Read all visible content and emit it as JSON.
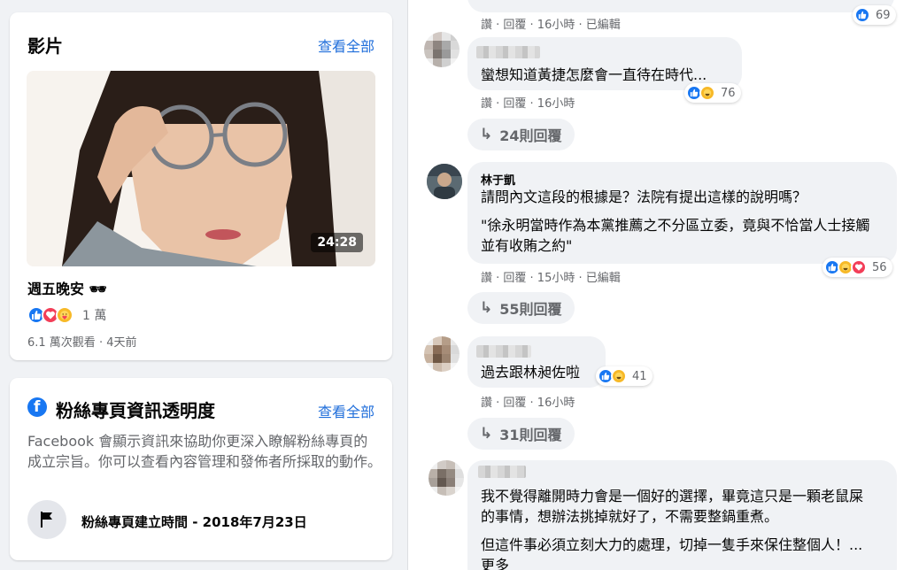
{
  "video_section": {
    "title": "影片",
    "see_all": "查看全部",
    "duration": "24:28",
    "video_title": "週五晚安 🕶",
    "reaction_count": "1 萬",
    "meta": "6.1 萬次觀看 · 4天前"
  },
  "transparency": {
    "title": "粉絲專頁資訊透明度",
    "see_all": "查看全部",
    "logo": "f",
    "description": "Facebook 會顯示資訊來協助你更深入瞭解粉絲專頁的成立宗旨。你可以查看內容管理和發佈者所採取的動作。",
    "created": "粉絲專頁建立時間 - 2018年7月23日",
    "icon": "flag-icon"
  },
  "comments": [
    {
      "meta": "讚 · 回覆 · 16小時 · 已編輯",
      "reaction_count": "69"
    },
    {
      "text": "蠻想知道黃捷怎麼會一直待在時代...",
      "meta": "讚 · 回覆 · 16小時",
      "reaction_count": "76",
      "replies": "24則回覆"
    },
    {
      "author": "林于凱",
      "text": "請問內文這段的根據是？法院有提出這樣的說明嗎？",
      "quote": "\"徐永明當時作為本黨推薦之不分區立委，竟與不恰當人士接觸並有收賄之約\"",
      "meta": "讚 · 回覆 · 15小時 · 已編輯",
      "reaction_count": "56",
      "replies": "55則回覆"
    },
    {
      "text": "過去跟林昶佐啦",
      "meta": "讚 · 回覆 · 16小時",
      "reaction_count": "41",
      "replies": "31則回覆"
    },
    {
      "text": "我不覺得離開時力會是一個好的選擇，畢竟這只是一顆老鼠屎的事情，想辦法挑掉就好了，不需要整鍋重煮。",
      "text2": "但這件事必須立刻大力的處理，切掉一隻手來保住整個人！... 更多"
    }
  ],
  "colors": {
    "accent": "#216fdb",
    "like": "#1877f2",
    "love": "#f33e58",
    "haha": "#f7b928",
    "page_bg": "#f0f2f5"
  }
}
